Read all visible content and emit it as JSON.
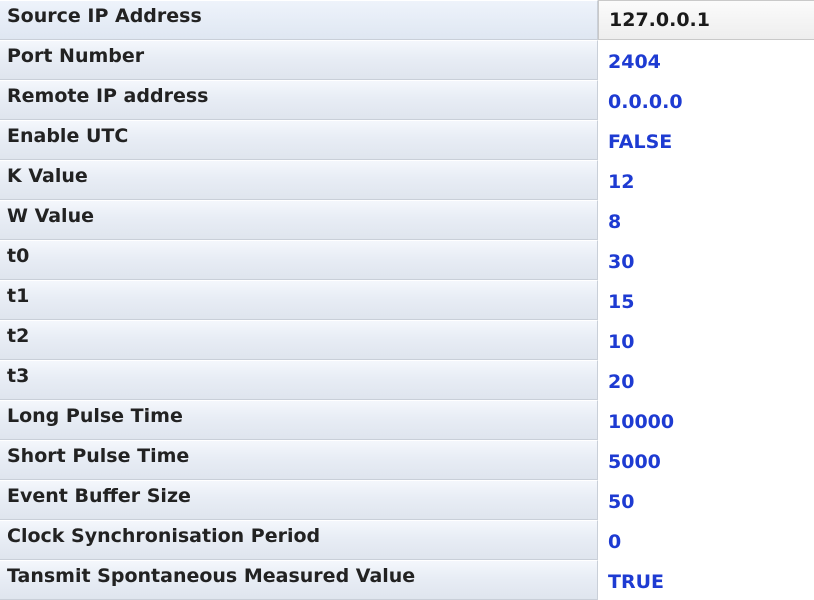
{
  "properties": [
    {
      "name": "Source IP Address",
      "value": "127.0.0.1"
    },
    {
      "name": "Port Number",
      "value": "2404"
    },
    {
      "name": "Remote IP address",
      "value": "0.0.0.0"
    },
    {
      "name": "Enable UTC",
      "value": "FALSE"
    },
    {
      "name": "K Value",
      "value": "12"
    },
    {
      "name": "W Value",
      "value": "8"
    },
    {
      "name": "t0",
      "value": "30"
    },
    {
      "name": "t1",
      "value": "15"
    },
    {
      "name": "t2",
      "value": "10"
    },
    {
      "name": "t3",
      "value": "20"
    },
    {
      "name": "Long Pulse Time",
      "value": "10000"
    },
    {
      "name": "Short Pulse Time",
      "value": "5000"
    },
    {
      "name": "Event Buffer Size",
      "value": "50"
    },
    {
      "name": "Clock Synchronisation Period",
      "value": "0"
    },
    {
      "name": "Tansmit Spontaneous Measured Value",
      "value": "TRUE"
    }
  ],
  "colors": {
    "value_text": "#1e3bd2",
    "name_text": "#222222",
    "name_background": "#e8edf5"
  }
}
